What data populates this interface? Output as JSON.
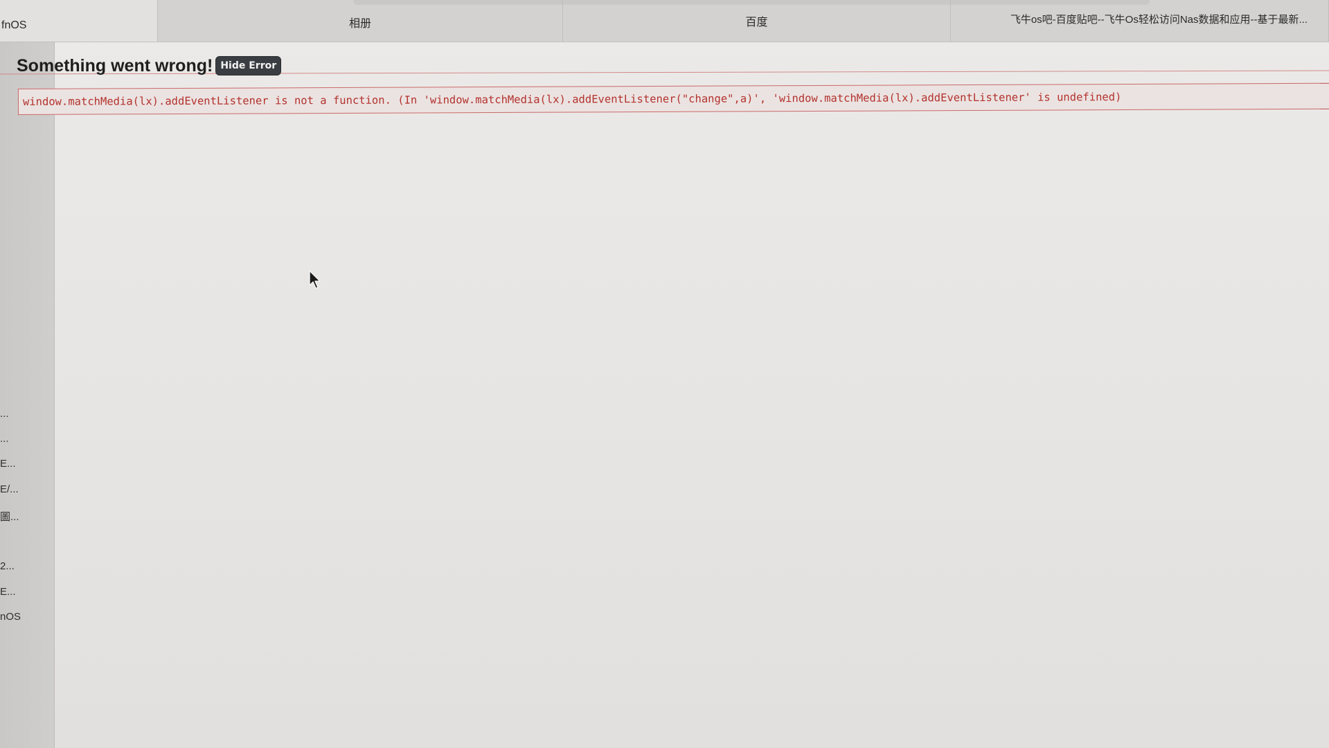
{
  "tabs": [
    {
      "label": "fnOS"
    },
    {
      "label": "相册"
    },
    {
      "label": "百度"
    },
    {
      "label": "飞牛os吧-百度贴吧--飞牛Os轻松访问Nas数据和应用--基于最新..."
    }
  ],
  "sidebar": {
    "items": [
      {
        "label": "..."
      },
      {
        "label": "..."
      },
      {
        "label": "E..."
      },
      {
        "label": "E/..."
      },
      {
        "label": "圖..."
      },
      {
        "label": "2..."
      },
      {
        "label": "E..."
      },
      {
        "label": "nOS"
      }
    ]
  },
  "error": {
    "title": "Something went wrong!",
    "hide_button": "Hide Error",
    "message": "window.matchMedia(lx).addEventListener is not a function. (In 'window.matchMedia(lx).addEventListener(\"change\",a)', 'window.matchMedia(lx).addEventListener' is undefined)"
  },
  "colors": {
    "error_text": "#b3322e",
    "error_border": "#c86a6a",
    "button_bg": "#3a3d41"
  },
  "icons": {
    "cursor": "mouse-pointer-icon"
  }
}
